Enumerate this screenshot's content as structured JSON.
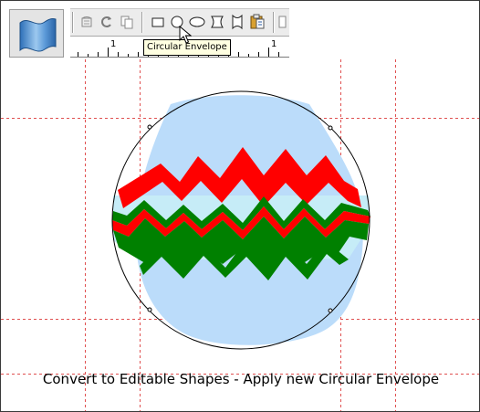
{
  "toolbar": {
    "envelope_tool_icon": "wave-envelope-icon",
    "buttons": [
      {
        "name": "remove-envelope-button",
        "icon": "remove-envelope-icon"
      },
      {
        "name": "copy-envelope-button",
        "icon": "copy-envelope-icon"
      },
      {
        "name": "paste-envelope-button",
        "icon": "paste-envelope-icon"
      },
      {
        "name": "rectangular-envelope-button",
        "icon": "rectangle-icon"
      },
      {
        "name": "circular-envelope-button",
        "icon": "circle-icon",
        "active": true
      },
      {
        "name": "elliptical-envelope-button",
        "icon": "ellipse-icon"
      },
      {
        "name": "hourglass-envelope-button",
        "icon": "hourglass-icon"
      },
      {
        "name": "bowtie-envelope-button",
        "icon": "bowtie-icon"
      },
      {
        "name": "clipboard-envelope-button",
        "icon": "clipboard-icon"
      }
    ]
  },
  "ruler": {
    "labels": [
      "1",
      "1"
    ]
  },
  "tooltip": {
    "text": "Circular Envelope"
  },
  "canvas": {
    "colors": {
      "egg_fill": "#bbdcfa",
      "red_stripe": "#ff0000",
      "green_stripe": "#008000",
      "light_band": "#c6ecf7",
      "guide_line": "#e05050",
      "envelope_outline": "#000000"
    }
  },
  "caption": {
    "text": "Convert to Editable Shapes - Apply new Circular Envelope"
  }
}
